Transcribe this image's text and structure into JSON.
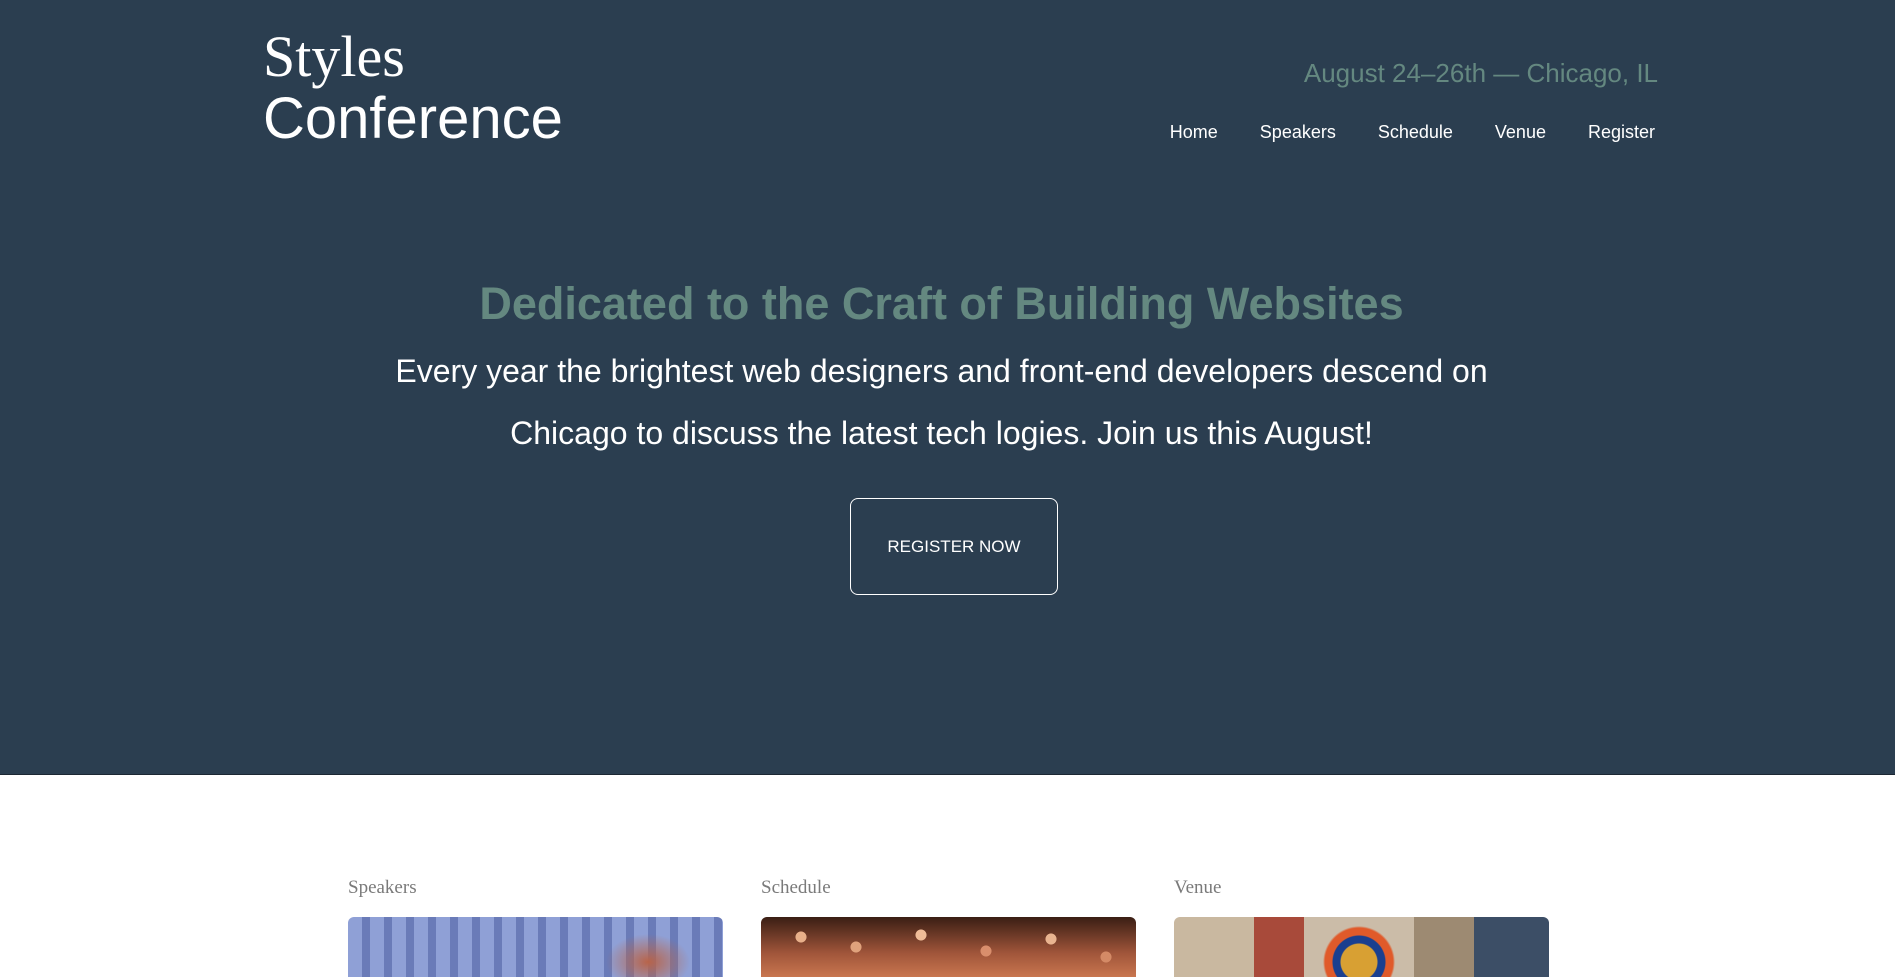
{
  "header": {
    "logo_line1": "Styles",
    "logo_line2": "Conference",
    "tagline": "August 24–26th — Chicago, IL",
    "nav": [
      {
        "label": "Home"
      },
      {
        "label": "Speakers"
      },
      {
        "label": "Schedule"
      },
      {
        "label": "Venue"
      },
      {
        "label": "Register"
      }
    ]
  },
  "hero": {
    "title": "Dedicated to the Craft of Building Websites",
    "text": "Every year the brightest web designers and front-end developers descend on Chicago to discuss the latest tech logies. Join us this August!",
    "cta_label": "Register Now"
  },
  "sections": [
    {
      "label": "Speakers",
      "image": "speaker-on-stage-photo"
    },
    {
      "label": "Schedule",
      "image": "audience-photo"
    },
    {
      "label": "Venue",
      "image": "chicago-theatre-sign-photo"
    }
  ],
  "colors": {
    "hero_bg": "#2b3e50",
    "accent": "#648880",
    "text_light": "#ffffff"
  }
}
